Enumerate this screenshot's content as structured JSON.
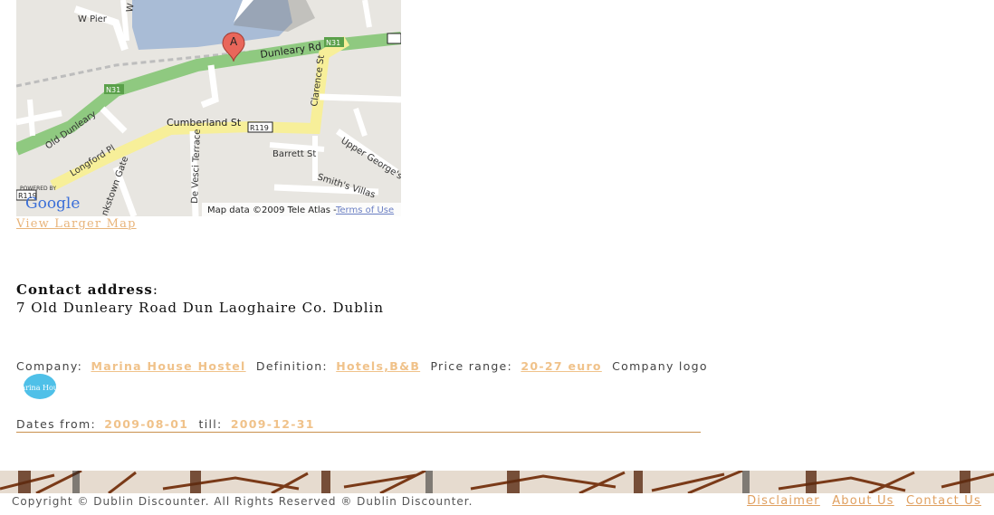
{
  "map": {
    "roads": {
      "w_pier": "W Pier",
      "w_pi": "W Pi",
      "dunleary_rd": "Dunleary Rd",
      "n31_a": "N31",
      "n31_b": "N31",
      "clarence_st": "Clarence St",
      "old_dunleary": "Old Dunleary",
      "cumberland_st": "Cumberland St",
      "r119_a": "R119",
      "r119_b": "R119",
      "longford_pl": "Longford Pl",
      "barrett_st": "Barrett St",
      "upper_georges": "Upper George's S",
      "de_vesci_terrace": "De Vesci Terrace",
      "smiths_villas": "Smith's Villas",
      "kinstown_gate": "nkstown Gate"
    },
    "marker_letter": "A",
    "powered_by": "POWERED BY",
    "google": "Google",
    "attribution": "Map data ©2009 Tele Atlas - ",
    "terms_link": "Terms of Use",
    "view_larger": "View Larger Map"
  },
  "contact": {
    "label": "Contact address",
    "colon": ":",
    "address": "7 Old Dunleary Road Dun Laoghaire Co. Dublin"
  },
  "listing": {
    "company_label": "Company:",
    "company_value": "Marina House Hostel",
    "definition_label": "Definition:",
    "definition_value": "Hotels,B&B",
    "price_label": "Price range:",
    "price_value": "20-27 euro",
    "logo_label": "Company logo",
    "logo_text": "Marina House",
    "dates_label": "Dates from:",
    "date_from": "2009-08-01",
    "till_label": "till:",
    "date_till": "2009-12-31"
  },
  "footer": {
    "copyright": "Copyright © Dublin Discounter. All Rights Reserved ® Dublin Discounter.",
    "links": [
      "Disclaimer",
      "About Us",
      "Contact Us"
    ]
  },
  "colors": {
    "link": "#e8b47a",
    "value": "#f0c28a",
    "rule": "#c9904e"
  }
}
